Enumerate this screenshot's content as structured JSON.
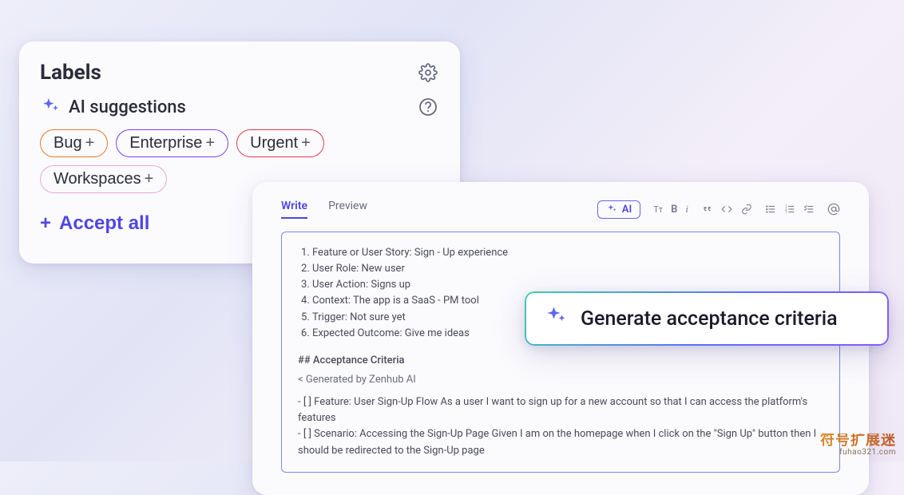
{
  "labels": {
    "title": "Labels",
    "sub_title": "AI suggestions",
    "accept_all": "Accept all",
    "chips": [
      {
        "label": "Bug",
        "color": "orange"
      },
      {
        "label": "Enterprise",
        "color": "purple"
      },
      {
        "label": "Urgent",
        "color": "red"
      },
      {
        "label": "Workspaces",
        "color": "pink"
      }
    ]
  },
  "editor": {
    "tabs": {
      "write": "Write",
      "preview": "Preview"
    },
    "ai_pill": "AI",
    "list": [
      "Feature or User Story: Sign - Up experience",
      "User Role: New user",
      "User Action: Signs up",
      "Context: The app is a SaaS - PM tool",
      "Trigger: Not sure yet",
      "Expected Outcome: Give me ideas"
    ],
    "criteria_header": "## Acceptance Criteria",
    "generated_by": "< Generated by Zenhub AI",
    "criteria": [
      "- [ ] Feature: User Sign-Up Flow As a user I want to sign up for a new account so that I can access the platform's features",
      "- [ ] Scenario: Accessing the Sign-Up Page Given I am on the homepage when I click on the \"Sign Up\" button then I should be redirected to the Sign-Up page"
    ]
  },
  "generate_btn": {
    "label": "Generate acceptance criteria"
  },
  "watermark": {
    "line1": "符号扩展迷",
    "line2": "fuhao321.com"
  }
}
